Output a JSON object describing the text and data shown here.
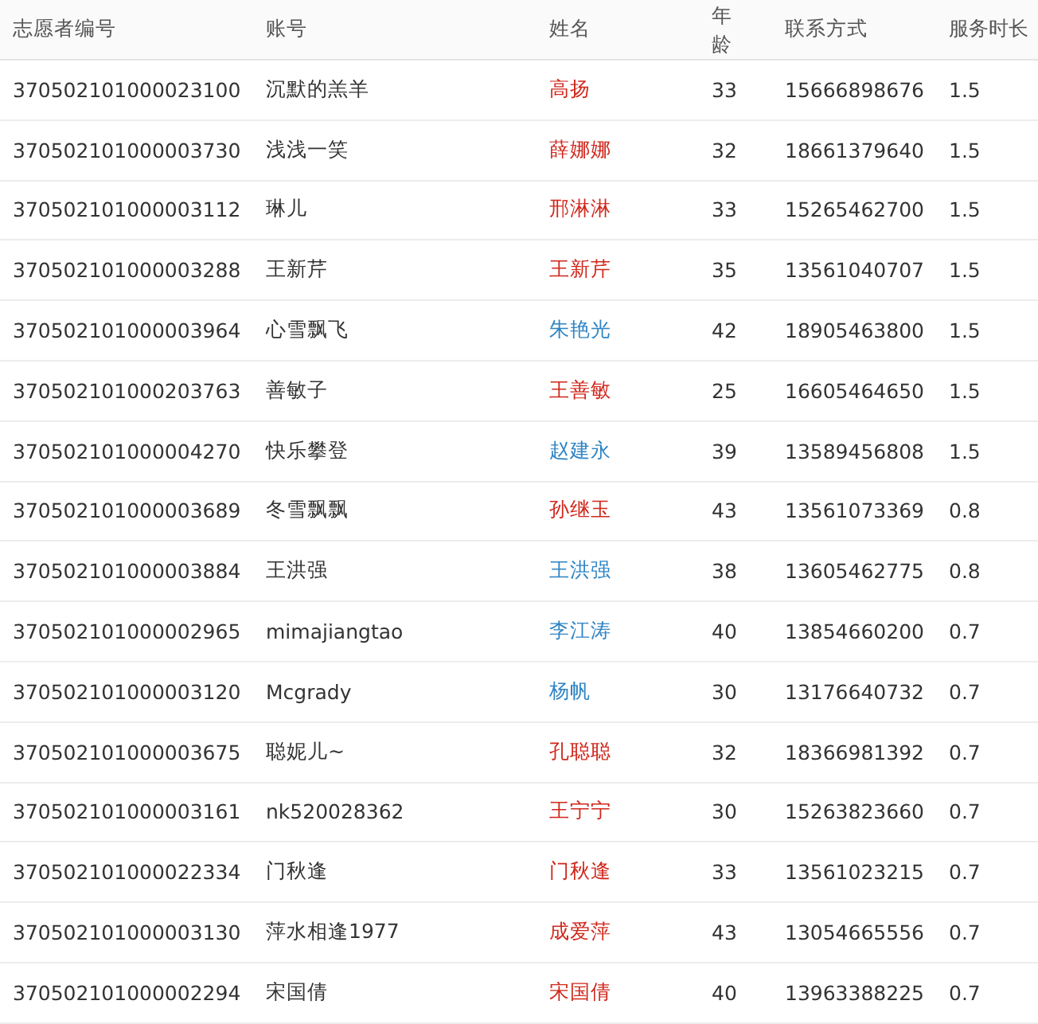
{
  "table": {
    "columns": [
      "志愿者编号",
      "账号",
      "姓名",
      "年龄",
      "联系方式",
      "服务时长"
    ],
    "rows": [
      {
        "id": "370502101000023100",
        "account": "沉默的羔羊",
        "name": "高扬",
        "color": "#d0281c",
        "age": "33",
        "phone": "15666898676",
        "hours": "1.5"
      },
      {
        "id": "370502101000003730",
        "account": "浅浅一笑",
        "name": "薛娜娜",
        "color": "#d0281c",
        "age": "32",
        "phone": "18661379640",
        "hours": "1.5"
      },
      {
        "id": "370502101000003112",
        "account": "琳儿",
        "name": "邢淋淋",
        "color": "#d0281c",
        "age": "33",
        "phone": "15265462700",
        "hours": "1.5"
      },
      {
        "id": "370502101000003288",
        "account": "王新芹",
        "name": "王新芹",
        "color": "#d0281c",
        "age": "35",
        "phone": "13561040707",
        "hours": "1.5"
      },
      {
        "id": "370502101000003964",
        "account": "心雪飘飞",
        "name": "朱艳光",
        "color": "#2f84c4",
        "age": "42",
        "phone": "18905463800",
        "hours": "1.5"
      },
      {
        "id": "370502101000203763",
        "account": "善敏子",
        "name": "王善敏",
        "color": "#d0281c",
        "age": "25",
        "phone": "16605464650",
        "hours": "1.5"
      },
      {
        "id": "370502101000004270",
        "account": "快乐攀登",
        "name": "赵建永",
        "color": "#2f84c4",
        "age": "39",
        "phone": "13589456808",
        "hours": "1.5"
      },
      {
        "id": "370502101000003689",
        "account": "冬雪飘飘",
        "name": "孙继玉",
        "color": "#d0281c",
        "age": "43",
        "phone": "13561073369",
        "hours": "0.8"
      },
      {
        "id": "370502101000003884",
        "account": "王洪强",
        "name": "王洪强",
        "color": "#2f84c4",
        "age": "38",
        "phone": "13605462775",
        "hours": "0.8"
      },
      {
        "id": "370502101000002965",
        "account": "mimajiangtao",
        "name": "李江涛",
        "color": "#2f84c4",
        "age": "40",
        "phone": "13854660200",
        "hours": "0.7"
      },
      {
        "id": "370502101000003120",
        "account": "Mcgrady",
        "name": "杨帆",
        "color": "#2f84c4",
        "age": "30",
        "phone": "13176640732",
        "hours": "0.7"
      },
      {
        "id": "370502101000003675",
        "account": "聪妮儿~",
        "name": "孔聪聪",
        "color": "#d0281c",
        "age": "32",
        "phone": "18366981392",
        "hours": "0.7"
      },
      {
        "id": "370502101000003161",
        "account": "nk520028362",
        "name": "王宁宁",
        "color": "#d0281c",
        "age": "30",
        "phone": "15263823660",
        "hours": "0.7"
      },
      {
        "id": "370502101000022334",
        "account": "门秋逢",
        "name": "门秋逢",
        "color": "#d0281c",
        "age": "33",
        "phone": "13561023215",
        "hours": "0.7"
      },
      {
        "id": "370502101000003130",
        "account": "萍水相逢1977",
        "name": "成爱萍",
        "color": "#d0281c",
        "age": "43",
        "phone": "13054665556",
        "hours": "0.7"
      },
      {
        "id": "370502101000002294",
        "account": "宋国倩",
        "name": "宋国倩",
        "color": "#d0281c",
        "age": "40",
        "phone": "13963388225",
        "hours": "0.7"
      }
    ]
  }
}
